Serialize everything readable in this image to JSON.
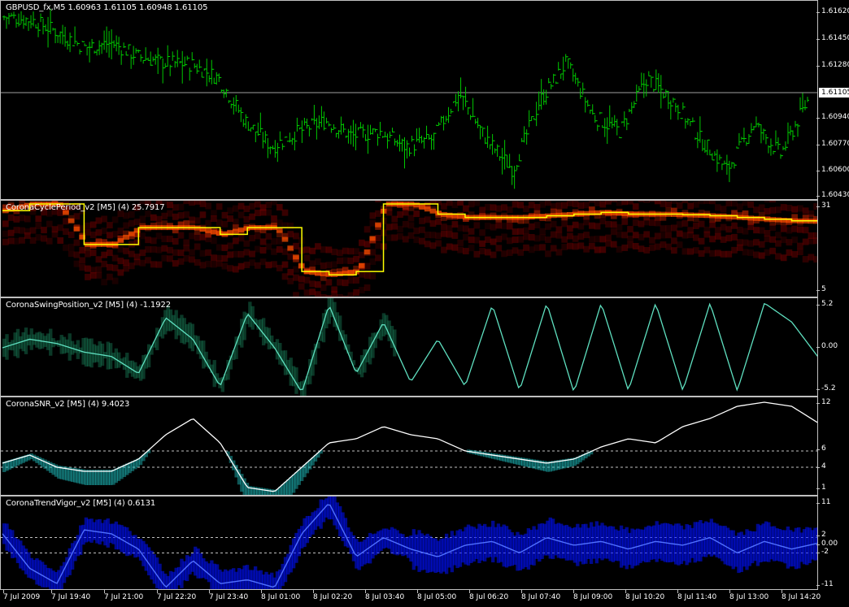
{
  "panes": [
    {
      "id": "price",
      "title": "GBPUSD_fx,M5  1.60963 1.61105 1.60948 1.61105",
      "yticks": [
        "1.61620",
        "1.61450",
        "1.61280",
        "1.61105",
        "1.60940",
        "1.60770",
        "1.60600",
        "1.60430"
      ],
      "current": "1.61105",
      "color": "#00c800"
    },
    {
      "id": "cycle",
      "title": "CoronaCyclePeriod_v2 [M5] (4) 25.7917",
      "yticks": [
        "31",
        "5"
      ],
      "color": "#ffff00"
    },
    {
      "id": "swing",
      "title": "CoronaSwingPosition_v2 [M5] (4) -1.1922",
      "yticks": [
        "5.2",
        "0.00",
        "-5.2"
      ],
      "color": "#5fe0c0"
    },
    {
      "id": "snr",
      "title": "CoronaSNR_v2 [M5] (4) 9.4023",
      "yticks": [
        "12",
        "6",
        "4",
        "1"
      ],
      "color": "#ffffff"
    },
    {
      "id": "trend",
      "title": "CoronaTrendVigor_v2 [M5] (4) 0.6131",
      "yticks": [
        "11",
        "2",
        "0.00",
        "-2",
        "-11"
      ],
      "color": "#2040ff"
    }
  ],
  "xaxis": [
    "7 Jul 2009",
    "7 Jul 19:40",
    "7 Jul 21:00",
    "7 Jul 22:20",
    "7 Jul 23:40",
    "8 Jul 01:00",
    "8 Jul 02:20",
    "8 Jul 03:40",
    "8 Jul 05:00",
    "8 Jul 06:20",
    "8 Jul 07:40",
    "8 Jul 09:00",
    "8 Jul 10:20",
    "8 Jul 11:40",
    "8 Jul 13:00",
    "8 Jul 14:20"
  ],
  "chart_data": [
    {
      "type": "line",
      "title": "GBPUSD_fx,M5",
      "ylim": [
        1.6043,
        1.6162
      ],
      "x_index": [
        0,
        10,
        20,
        30,
        40,
        50,
        60,
        70,
        80,
        90,
        100,
        110,
        120,
        130,
        140,
        150,
        160,
        170,
        180,
        190,
        200,
        210,
        220,
        230,
        240,
        250,
        260,
        270,
        280,
        290,
        300
      ],
      "values": [
        1.616,
        1.6158,
        1.615,
        1.614,
        1.6143,
        1.6134,
        1.613,
        1.6129,
        1.612,
        1.6092,
        1.6075,
        1.6085,
        1.6092,
        1.6082,
        1.6085,
        1.6075,
        1.608,
        1.611,
        1.608,
        1.606,
        1.6105,
        1.613,
        1.6095,
        1.6085,
        1.612,
        1.6105,
        1.608,
        1.606,
        1.609,
        1.607,
        1.6105
      ]
    },
    {
      "type": "line",
      "title": "CoronaCyclePeriod_v2",
      "ylim": [
        5,
        31
      ],
      "values": [
        29,
        31,
        31,
        19,
        19,
        24,
        24,
        24,
        22,
        24,
        24,
        11,
        10,
        11,
        31,
        31,
        28,
        27,
        27,
        27,
        27.5,
        28,
        28.5,
        28,
        28,
        27.8,
        27.5,
        27,
        26.5,
        26,
        25.8
      ]
    },
    {
      "type": "line",
      "title": "CoronaSwingPosition_v2",
      "ylim": [
        -5.2,
        5.2
      ],
      "values": [
        0,
        1,
        0.5,
        -0.5,
        -1,
        -3,
        3.5,
        1,
        -4.5,
        4,
        0,
        -5.2,
        5,
        -3,
        3,
        -4,
        1,
        -4.5,
        5,
        -5,
        5.2,
        -5.2,
        5.2,
        -5,
        5.2,
        -5,
        5.2,
        -5,
        5.2,
        3,
        -1.2
      ]
    },
    {
      "type": "line",
      "title": "CoronaSNR_v2",
      "ylim": [
        1,
        12
      ],
      "values": [
        4.5,
        5.5,
        4,
        3.5,
        3.5,
        5,
        8,
        10,
        7,
        1.5,
        1,
        4,
        7,
        7.5,
        9,
        8,
        7.5,
        6,
        5.5,
        5,
        4.5,
        5,
        6.5,
        7.5,
        7,
        9,
        10,
        11.5,
        12,
        11.5,
        9.4
      ]
    },
    {
      "type": "line",
      "title": "CoronaTrendVigor_v2",
      "ylim": [
        -11,
        11
      ],
      "values": [
        3,
        -6,
        -10,
        4,
        3,
        -1,
        -11,
        -4,
        -10,
        -9,
        -11,
        3,
        11,
        -3,
        2,
        -1,
        -3,
        0,
        1,
        -2,
        2,
        0,
        1,
        -1,
        1,
        0,
        2,
        -2,
        1,
        -1,
        0.6
      ]
    }
  ]
}
